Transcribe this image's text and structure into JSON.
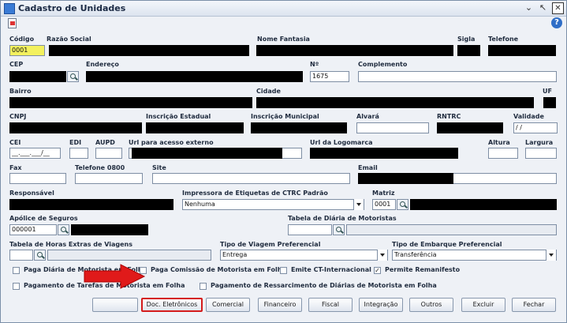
{
  "window": {
    "title": "Cadastro de Unidades",
    "controls": [
      "⌄",
      "↖",
      "✕"
    ]
  },
  "form": {
    "codigo": {
      "label": "Código",
      "value": "0001"
    },
    "razao_social": {
      "label": "Razão Social"
    },
    "nome_fantasia": {
      "label": "Nome Fantasia"
    },
    "sigla": {
      "label": "Sigla"
    },
    "telefone": {
      "label": "Telefone"
    },
    "cep": {
      "label": "CEP"
    },
    "endereco": {
      "label": "Endereço"
    },
    "numero": {
      "label": "Nº",
      "value": "1675"
    },
    "complemento": {
      "label": "Complemento"
    },
    "bairro": {
      "label": "Bairro"
    },
    "cidade": {
      "label": "Cidade"
    },
    "uf": {
      "label": "UF"
    },
    "cnpj": {
      "label": "CNPJ"
    },
    "inscricao_estadual": {
      "label": "Inscrição Estadual"
    },
    "inscricao_municipal": {
      "label": "Inscrição Municipal"
    },
    "alvara": {
      "label": "Alvará"
    },
    "rntrc": {
      "label": "RNTRC"
    },
    "validade": {
      "label": "Validade",
      "value": "/ /"
    },
    "cei": {
      "label": "CEI",
      "value": "__.___.___/__"
    },
    "edi": {
      "label": "EDI"
    },
    "aupd": {
      "label": "AUPD"
    },
    "url_acesso": {
      "label": "Url para acesso externo"
    },
    "url_logomarca": {
      "label": "Url da Logomarca"
    },
    "altura": {
      "label": "Altura"
    },
    "largura": {
      "label": "Largura"
    },
    "fax": {
      "label": "Fax"
    },
    "telefone0800": {
      "label": "Telefone 0800"
    },
    "site": {
      "label": "Site"
    },
    "email": {
      "label": "Email"
    },
    "responsavel": {
      "label": "Responsável"
    },
    "impressora": {
      "label": "Impressora de Etiquetas de CTRC Padrão",
      "value": "Nenhuma"
    },
    "matriz": {
      "label": "Matriz",
      "value": "0001"
    },
    "apolice": {
      "label": "Apólice de Seguros",
      "value": "000001"
    },
    "tabela_diaria": {
      "label": "Tabela de Diária de Motoristas"
    },
    "tabela_horas": {
      "label": "Tabela de Horas Extras de Viagens"
    },
    "tipo_viagem": {
      "label": "Tipo de Viagem Preferencial",
      "value": "Entrega"
    },
    "tipo_embarque": {
      "label": "Tipo de Embarque Preferencial",
      "value": "Transferência"
    }
  },
  "checkboxes": [
    {
      "label": "Paga Diária de Motorista em Folha",
      "checked": false
    },
    {
      "label": "Paga Comissão de Motorista em Folha",
      "checked": false
    },
    {
      "label": "Emite CT-Internacional",
      "checked": false
    },
    {
      "label": "Permite Remanifesto",
      "checked": true
    },
    {
      "label": "Pagamento de Tarefas de Motorista em Folha",
      "checked": false
    },
    {
      "label": "Pagamento de Ressarcimento de Diárias de Motorista em Folha",
      "checked": false
    }
  ],
  "buttons": [
    "Doc. Eletrônicos",
    "Comercial",
    "Financeiro",
    "Fiscal",
    "Integração",
    "Outros",
    "Excluir",
    "Fechar"
  ],
  "checkmark": "✓",
  "help_glyph": "?",
  "colors": {
    "highlight": "#d41b1b",
    "required_field": "#f3f15e"
  }
}
